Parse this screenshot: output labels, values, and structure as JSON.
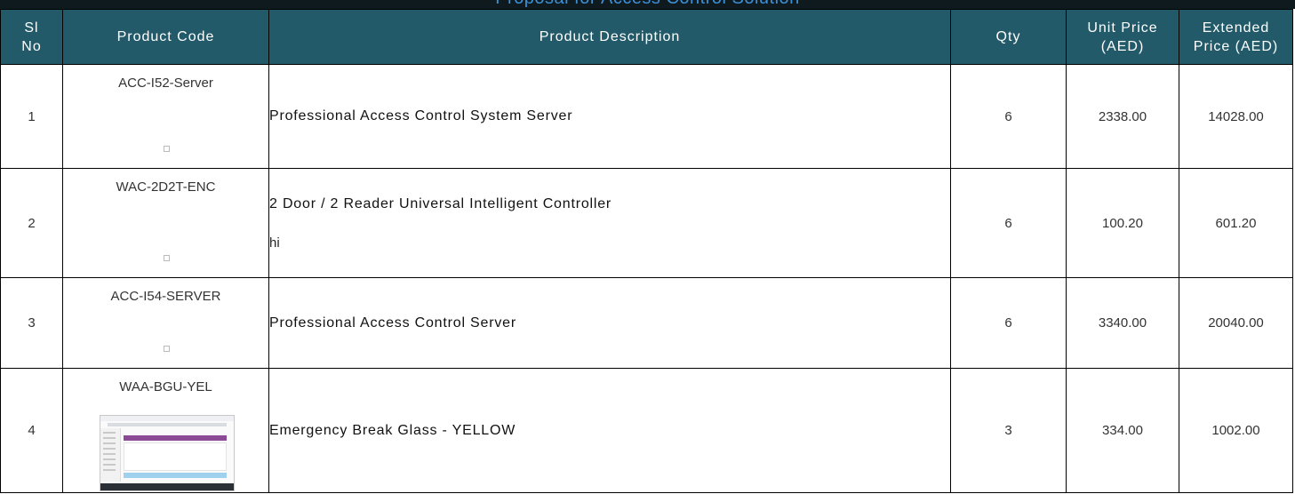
{
  "title": "Proposal for Access Control Solution",
  "headers": {
    "sl_no": [
      "Sl",
      "No"
    ],
    "product_code": "Product Code",
    "product_description": "Product Description",
    "qty": "Qty",
    "unit_price": [
      "Unit Price",
      "(AED)"
    ],
    "extended_price": [
      "Extended",
      "Price (AED)"
    ]
  },
  "rows": [
    {
      "sl": "1",
      "code": "ACC-I52-Server",
      "description": "Professional Access Control System Server",
      "note": "",
      "qty": "6",
      "unit_price": "2338.00",
      "extended_price": "14028.00"
    },
    {
      "sl": "2",
      "code": "WAC-2D2T-ENC",
      "description": "2 Door / 2 Reader Universal Intelligent Controller",
      "note": "hi",
      "qty": "6",
      "unit_price": "100.20",
      "extended_price": "601.20"
    },
    {
      "sl": "3",
      "code": "ACC-I54-SERVER",
      "description": "Professional Access Control Server",
      "note": "",
      "qty": "6",
      "unit_price": "3340.00",
      "extended_price": "20040.00"
    },
    {
      "sl": "4",
      "code": "WAA-BGU-YEL",
      "description": "Emergency Break Glass - YELLOW",
      "note": "",
      "qty": "3",
      "unit_price": "334.00",
      "extended_price": "1002.00"
    }
  ]
}
